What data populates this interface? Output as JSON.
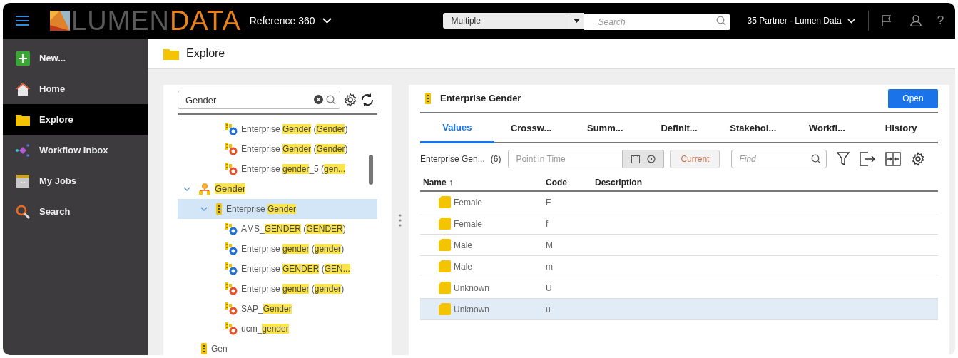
{
  "topbar": {
    "brand_light": "LUMEN",
    "brand_bold": "DATA",
    "product": "Reference 360",
    "scope": "Multiple",
    "search_placeholder": "Search",
    "org": "35 Partner - Lumen Data",
    "help": "?"
  },
  "sidebar": {
    "items": [
      {
        "label": "New...",
        "kind": "new",
        "selected": false
      },
      {
        "label": "Home",
        "kind": "home",
        "selected": false
      },
      {
        "label": "Explore",
        "kind": "explore",
        "selected": true
      },
      {
        "label": "Workflow Inbox",
        "kind": "workflow",
        "selected": false
      },
      {
        "label": "My Jobs",
        "kind": "jobs",
        "selected": false
      },
      {
        "label": "Search",
        "kind": "search",
        "selected": false
      }
    ]
  },
  "page_title": "Explore",
  "tree_panel": {
    "search_value": "Gender",
    "items": [
      {
        "kind": "crosswalk",
        "color": "#1f6fd6",
        "selected": false,
        "segments": [
          {
            "text": "Enterprise ",
            "hl": false
          },
          {
            "text": "Gender",
            "hl": true
          },
          {
            "text": " (",
            "hl": false
          },
          {
            "text": "Gender",
            "hl": true
          },
          {
            "text": ")",
            "hl": false
          }
        ]
      },
      {
        "kind": "crosswalk",
        "color": "#e8502a",
        "selected": false,
        "segments": [
          {
            "text": "Enterprise ",
            "hl": false
          },
          {
            "text": "Gender",
            "hl": true
          },
          {
            "text": " (",
            "hl": false
          },
          {
            "text": "Gender",
            "hl": true
          },
          {
            "text": ")",
            "hl": false
          }
        ]
      },
      {
        "kind": "crosswalk",
        "color": "#e8502a",
        "selected": false,
        "segments": [
          {
            "text": "Enterprise ",
            "hl": false
          },
          {
            "text": "gender",
            "hl": true
          },
          {
            "text": "_5 (",
            "hl": false
          },
          {
            "text": "gen...",
            "hl": true
          }
        ]
      },
      {
        "kind": "hierarchy",
        "expanded": true,
        "selected": false,
        "segments": [
          {
            "text": "Gender",
            "hl": true
          }
        ],
        "children": [
          {
            "kind": "entity",
            "expanded": true,
            "selected": true,
            "segments": [
              {
                "text": "Enterprise ",
                "hl": false
              },
              {
                "text": "Gender",
                "hl": true
              }
            ],
            "children": [
              {
                "kind": "crosswalk",
                "color": "#1f6fd6",
                "selected": false,
                "segments": [
                  {
                    "text": "AMS_",
                    "hl": false
                  },
                  {
                    "text": "GENDER",
                    "hl": true
                  },
                  {
                    "text": " (",
                    "hl": false
                  },
                  {
                    "text": "GENDER",
                    "hl": true
                  },
                  {
                    "text": ")",
                    "hl": false
                  }
                ]
              },
              {
                "kind": "crosswalk",
                "color": "#1f6fd6",
                "selected": false,
                "segments": [
                  {
                    "text": "Enterprise ",
                    "hl": false
                  },
                  {
                    "text": "gender",
                    "hl": true
                  },
                  {
                    "text": " (",
                    "hl": false
                  },
                  {
                    "text": "gender",
                    "hl": true
                  },
                  {
                    "text": ")",
                    "hl": false
                  }
                ]
              },
              {
                "kind": "crosswalk",
                "color": "#1f6fd6",
                "selected": false,
                "segments": [
                  {
                    "text": "Enterprise ",
                    "hl": false
                  },
                  {
                    "text": "GENDER",
                    "hl": true
                  },
                  {
                    "text": " (",
                    "hl": false
                  },
                  {
                    "text": "GEN...",
                    "hl": true
                  }
                ]
              },
              {
                "kind": "crosswalk",
                "color": "#e8502a",
                "selected": false,
                "segments": [
                  {
                    "text": "Enterprise ",
                    "hl": false
                  },
                  {
                    "text": "gender",
                    "hl": true
                  },
                  {
                    "text": " (",
                    "hl": false
                  },
                  {
                    "text": "gender",
                    "hl": true
                  },
                  {
                    "text": ")",
                    "hl": false
                  }
                ]
              },
              {
                "kind": "crosswalk",
                "color": "#e8502a",
                "selected": false,
                "segments": [
                  {
                    "text": "SAP_",
                    "hl": false
                  },
                  {
                    "text": "Gender",
                    "hl": true
                  }
                ]
              },
              {
                "kind": "crosswalk",
                "color": "#e8502a",
                "selected": false,
                "segments": [
                  {
                    "text": "ucm_",
                    "hl": false
                  },
                  {
                    "text": "gender",
                    "hl": true
                  }
                ]
              }
            ]
          }
        ]
      },
      {
        "kind": "entity",
        "selected": false,
        "segments": [
          {
            "text": "Gen",
            "hl": false
          }
        ]
      }
    ]
  },
  "detail": {
    "title": "Enterprise Gender",
    "open_button": "Open",
    "tabs": [
      {
        "label": "Values",
        "selected": true
      },
      {
        "label": "Crossw...",
        "selected": false
      },
      {
        "label": "Summ...",
        "selected": false
      },
      {
        "label": "Definit...",
        "selected": false
      },
      {
        "label": "Stakehol...",
        "selected": false
      },
      {
        "label": "Workfl...",
        "selected": false
      },
      {
        "label": "History",
        "selected": false
      }
    ],
    "toolbar": {
      "entity": "Enterprise Gen...",
      "count": "(6)",
      "date_placeholder": "Point in Time",
      "current_button": "Current",
      "current_disabled": true,
      "find_placeholder": "Find"
    },
    "table": {
      "columns": [
        "Name ↑",
        "Code",
        "Description"
      ],
      "rows": [
        {
          "name": "Female",
          "code": "F",
          "selected": false
        },
        {
          "name": "Female",
          "code": "f",
          "selected": false
        },
        {
          "name": "Male",
          "code": "M",
          "selected": false
        },
        {
          "name": "Male",
          "code": "m",
          "selected": false
        },
        {
          "name": "Unknown",
          "code": "U",
          "selected": false
        },
        {
          "name": "Unknown",
          "code": "u",
          "selected": true
        }
      ]
    }
  }
}
